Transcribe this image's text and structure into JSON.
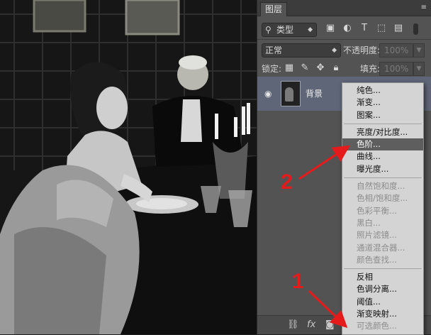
{
  "panel": {
    "tab_label": "图层",
    "panel_menu_icon": "panel-menu-icon",
    "filter": {
      "kind_label": "类型",
      "icons": [
        "image-filter-icon",
        "adjustment-filter-icon",
        "type-filter-icon",
        "shape-filter-icon",
        "smartobject-filter-icon"
      ]
    },
    "blend_mode": "正常",
    "opacity_label": "不透明度:",
    "opacity_value": "100%",
    "lock_label": "锁定:",
    "fill_label": "填充:",
    "fill_value": "100%",
    "layer": {
      "name": "背景",
      "visible": true
    }
  },
  "adjustment_menu": {
    "groups": [
      {
        "items": [
          {
            "label": "纯色...",
            "enabled": true
          },
          {
            "label": "渐变...",
            "enabled": true
          },
          {
            "label": "图案...",
            "enabled": true
          }
        ]
      },
      {
        "items": [
          {
            "label": "亮度/对比度...",
            "enabled": true
          },
          {
            "label": "色阶...",
            "enabled": true,
            "highlighted": true
          },
          {
            "label": "曲线...",
            "enabled": true
          },
          {
            "label": "曝光度...",
            "enabled": true
          }
        ]
      },
      {
        "items": [
          {
            "label": "自然饱和度...",
            "enabled": false
          },
          {
            "label": "色相/饱和度...",
            "enabled": false
          },
          {
            "label": "色彩平衡...",
            "enabled": false
          },
          {
            "label": "黑白...",
            "enabled": false
          },
          {
            "label": "照片滤镜...",
            "enabled": false
          },
          {
            "label": "通道混合器...",
            "enabled": false
          },
          {
            "label": "颜色查找...",
            "enabled": false
          }
        ]
      },
      {
        "items": [
          {
            "label": "反相",
            "enabled": true
          },
          {
            "label": "色调分离...",
            "enabled": true
          },
          {
            "label": "阈值...",
            "enabled": true
          },
          {
            "label": "渐变映射...",
            "enabled": true
          },
          {
            "label": "可选颜色...",
            "enabled": false
          }
        ]
      }
    ]
  },
  "annotations": {
    "callout_1": "1",
    "callout_2": "2",
    "color": "#e51b1b"
  },
  "bottom_icons": [
    "link-layers-icon",
    "fx-icon",
    "mask-icon",
    "adjustment-layer-icon"
  ]
}
